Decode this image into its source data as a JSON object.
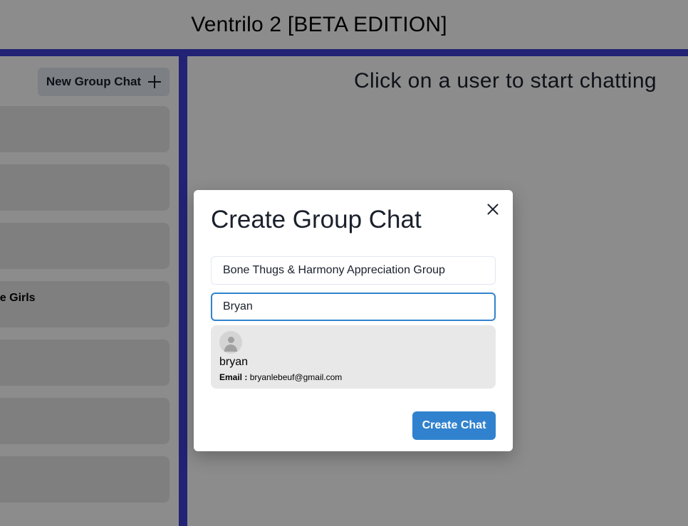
{
  "app": {
    "title": "Ventrilo 2 [BETA EDITION]"
  },
  "sidebar": {
    "new_group_label": "New Group Chat",
    "new_group_icon": "plus-icon",
    "chats": [
      {
        "name": ""
      },
      {
        "name": ""
      },
      {
        "name": ""
      },
      {
        "name": "de Girls"
      },
      {
        "name": ""
      },
      {
        "name": ""
      },
      {
        "name": ""
      }
    ]
  },
  "main": {
    "empty_message": "Click on a user to start chatting"
  },
  "modal": {
    "title": "Create Group Chat",
    "close_icon": "close-icon",
    "chat_name_value": "Bone Thugs & Harmony Appreciation Group",
    "search_value": "Bryan",
    "result": {
      "name": "bryan",
      "email_label": "Email :",
      "email": "bryanlebeuf@gmail.com"
    },
    "create_label": "Create Chat"
  },
  "colors": {
    "accent_stripe": "#3f40d6",
    "primary_button": "#3182ce",
    "focus_border": "#3182ce",
    "list_item_bg": "#e8e8e8"
  }
}
